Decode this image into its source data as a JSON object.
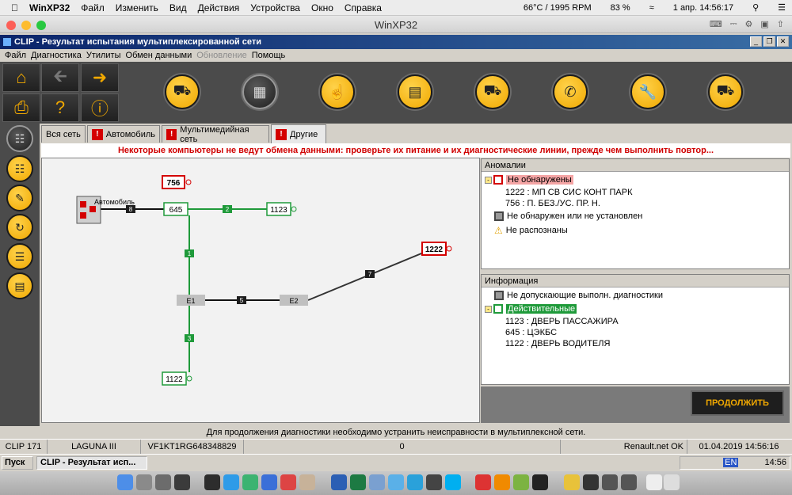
{
  "mac_menubar": {
    "apple": "",
    "app": "WinXP32",
    "items": [
      "Файл",
      "Изменить",
      "Вид",
      "Действия",
      "Устройства",
      "Окно",
      "Справка"
    ],
    "temp": "66°C / 1995 RPM",
    "battery": "83 %",
    "clock": "1 апр.  14:56:17"
  },
  "mac_window": {
    "title": "WinXP32"
  },
  "xp_window": {
    "title": "CLIP - Результат испытания мультиплексированной сети"
  },
  "menu": {
    "items": [
      "Файл",
      "Диагностика",
      "Утилиты",
      "Обмен данными",
      "Обновление",
      "Помощь"
    ]
  },
  "tabs": [
    "Вся сеть",
    "Автомобиль",
    "Мультимедийная сеть",
    "Другие"
  ],
  "message": "Некоторые компьютеры не ведут обмена данными: проверьте их питание и их диагностические линии, прежде чем выполнить повтор...",
  "network": {
    "vehicle_label": "Автомобиль",
    "nodes": [
      "756",
      "645",
      "1123",
      "1222",
      "1122",
      "E1",
      "E2"
    ],
    "links": [
      "8",
      "2",
      "1",
      "5",
      "7",
      "3"
    ]
  },
  "anomalies": {
    "title": "Аномалии",
    "not_found": "Не обнаружены",
    "items": [
      "1222 : МП СВ СИС КОНТ ПАРК",
      "756 : П. БЕЗ./УС. ПР. Н."
    ],
    "not_installed": "Не обнаружен или не установлен",
    "unrecognized": "Не распознаны"
  },
  "info": {
    "title": "Информация",
    "no_diag": "Не допускающие выполн. диагностики",
    "valid": "Действительные",
    "items": [
      "1123 : ДВЕРЬ ПАССАЖИРА",
      "645 : ЦЭКБС",
      "1122 : ДВЕРЬ ВОДИТЕЛЯ"
    ]
  },
  "continue_label": "ПРОДОЛЖИТЬ",
  "status_message": "Для продолжения диагностики необходимо устранить неисправности в мультиплексной сети.",
  "statusbar": {
    "clip": "CLIP 171",
    "model": "LAGUNA III",
    "vin": "VF1KT1RG648348829",
    "count": "0",
    "server": "Renault.net OK",
    "datetime": "01.04.2019 14:56:16"
  },
  "taskbar": {
    "start": "Пуск",
    "item": "CLIP - Результат исп...",
    "lang": "EN",
    "time": "14:56"
  },
  "colors": {
    "accent": "#f0a800",
    "ok": "#1f9a3a",
    "error": "#d40000"
  }
}
